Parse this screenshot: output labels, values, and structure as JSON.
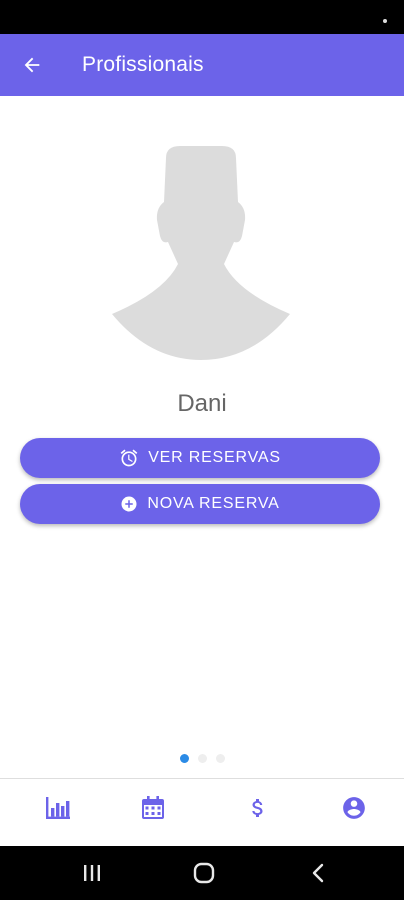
{
  "app_bar": {
    "title": "Profissionais",
    "back_icon": "arrow-left-icon",
    "background_color": "#6c63e9"
  },
  "profile": {
    "name": "Dani",
    "avatar_icon": "default-person-silhouette"
  },
  "actions": {
    "view_bookings": {
      "label": "VER RESERVAS",
      "icon": "alarm-clock-icon"
    },
    "new_booking": {
      "label": "NOVA RESERVA",
      "icon": "add-circle-icon"
    }
  },
  "pager": {
    "total": 3,
    "active": 1
  },
  "bottom_nav": {
    "items": [
      {
        "id": "stats",
        "icon": "bar-chart-icon"
      },
      {
        "id": "calendar",
        "icon": "calendar-icon"
      },
      {
        "id": "payments",
        "icon": "dollar-icon"
      },
      {
        "id": "account",
        "icon": "account-circle-icon"
      }
    ]
  },
  "system_nav": {
    "icons": [
      "recent-apps-icon",
      "home-icon",
      "back-icon"
    ]
  }
}
